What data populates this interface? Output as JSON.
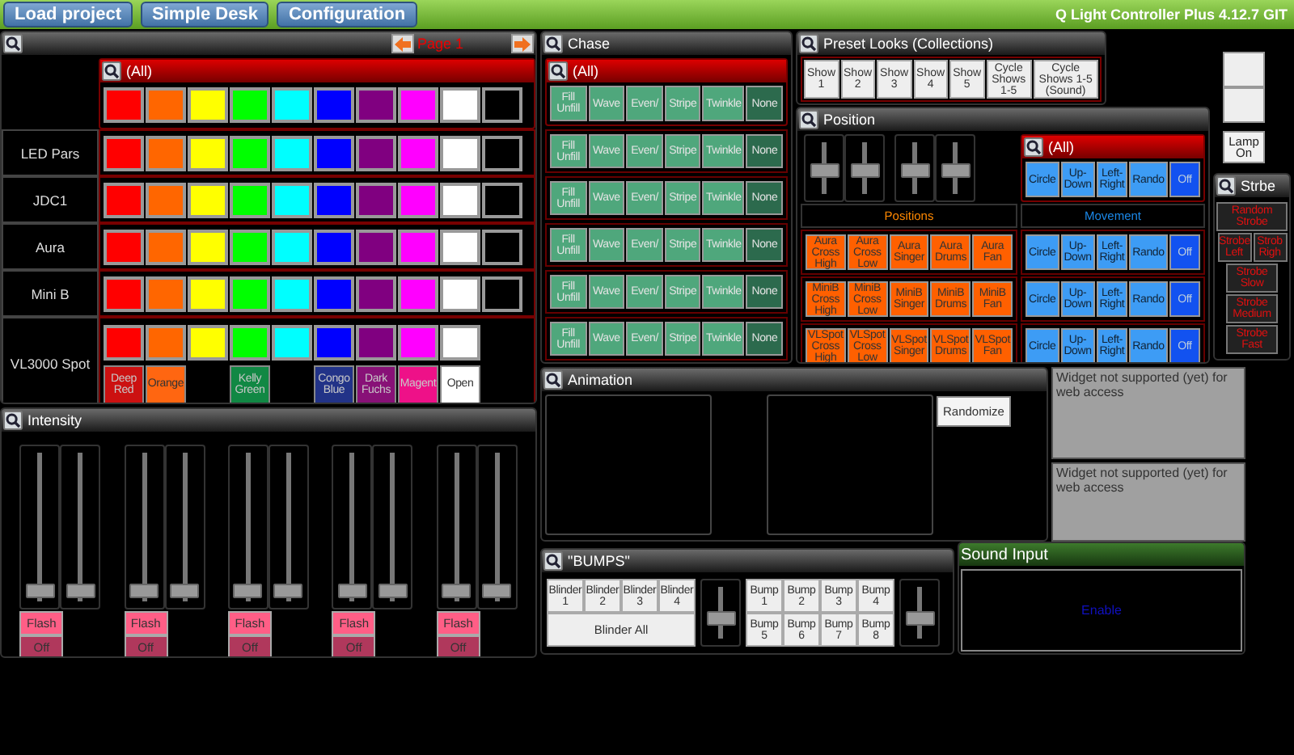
{
  "toolbar": {
    "buttons": [
      "Load project",
      "Simple Desk",
      "Configuration"
    ],
    "title": "Q Light Controller Plus 4.12.7 GIT"
  },
  "main": {
    "page": "Page 1",
    "all": {
      "title": "(All)",
      "colors": [
        {
          "color": "#ff0000"
        },
        {
          "color": "#ff6600"
        },
        {
          "color": "#ffff00"
        },
        {
          "color": "#00ff00"
        },
        {
          "color": "#00ffff"
        },
        {
          "color": "#0000ff"
        },
        {
          "color": "#800080"
        },
        {
          "color": "#ff00ff"
        },
        {
          "color": "#ffffff"
        },
        {
          "color": "#000000"
        }
      ]
    },
    "fixtures": [
      {
        "name": "LED Pars",
        "colors": [
          {
            "color": "#ff0000"
          },
          {
            "color": "#ff6600"
          },
          {
            "color": "#ffff00"
          },
          {
            "color": "#00ff00"
          },
          {
            "color": "#00ffff"
          },
          {
            "color": "#0000ff"
          },
          {
            "color": "#800080"
          },
          {
            "color": "#ff00ff"
          },
          {
            "color": "#ffffff"
          },
          {
            "color": "#000000"
          }
        ]
      },
      {
        "name": "JDC1",
        "colors": [
          {
            "color": "#ff0000"
          },
          {
            "color": "#ff6600"
          },
          {
            "color": "#ffff00"
          },
          {
            "color": "#00ff00"
          },
          {
            "color": "#00ffff"
          },
          {
            "color": "#0000ff"
          },
          {
            "color": "#800080"
          },
          {
            "color": "#ff00ff"
          },
          {
            "color": "#ffffff"
          },
          {
            "color": "#000000"
          }
        ]
      },
      {
        "name": "Aura",
        "colors": [
          {
            "color": "#ff0000"
          },
          {
            "color": "#ff6600"
          },
          {
            "color": "#ffff00"
          },
          {
            "color": "#00ff00"
          },
          {
            "color": "#00ffff"
          },
          {
            "color": "#0000ff"
          },
          {
            "color": "#800080"
          },
          {
            "color": "#ff00ff"
          },
          {
            "color": "#ffffff"
          },
          {
            "color": "#000000"
          }
        ]
      },
      {
        "name": "Mini B",
        "colors": [
          {
            "color": "#ff0000"
          },
          {
            "color": "#ff6600"
          },
          {
            "color": "#ffff00"
          },
          {
            "color": "#00ff00"
          },
          {
            "color": "#00ffff"
          },
          {
            "color": "#0000ff"
          },
          {
            "color": "#800080"
          },
          {
            "color": "#ff00ff"
          },
          {
            "color": "#ffffff"
          },
          {
            "color": "#000000"
          }
        ]
      },
      {
        "name": "VL3000 Spot",
        "colors": [
          {
            "color": "#ff0000"
          },
          {
            "color": "#ff6600"
          },
          {
            "color": "#ffff00"
          },
          {
            "color": "#00ff00"
          },
          {
            "color": "#00ffff"
          },
          {
            "color": "#0000ff"
          },
          {
            "color": "#800080"
          },
          {
            "color": "#ff00ff"
          },
          {
            "color": "#ffffff"
          }
        ],
        "presets": [
          {
            "kind": "button",
            "label": "Deep Red",
            "color": "#cc1111"
          },
          {
            "kind": "button",
            "label": "Orange",
            "color": "#ff6611"
          },
          {
            "kind": "blank"
          },
          {
            "kind": "button",
            "label": "Kelly Green",
            "color": "#118844"
          },
          {
            "kind": "blank"
          },
          {
            "kind": "button",
            "label": "Congo Blue",
            "color": "#223388"
          },
          {
            "kind": "button",
            "label": "Dark Fuchs",
            "color": "#881177"
          },
          {
            "kind": "button",
            "label": "Magent",
            "color": "#ee1188"
          },
          {
            "kind": "button",
            "label": "Open",
            "color": "#ffffff"
          }
        ]
      }
    ]
  },
  "chase": {
    "title": "Chase",
    "group": "(All)",
    "rows": [
      {
        "buttons": [
          {
            "label": "Fill Unfill",
            "selected": false
          },
          {
            "label": "Wave",
            "selected": false
          },
          {
            "label": "Even/",
            "selected": false
          },
          {
            "label": "Stripe",
            "selected": false
          },
          {
            "label": "Twinkle",
            "selected": false
          },
          {
            "label": "None",
            "selected": true
          }
        ]
      },
      {
        "buttons": [
          {
            "label": "Fill Unfill",
            "selected": false
          },
          {
            "label": "Wave",
            "selected": false
          },
          {
            "label": "Even/",
            "selected": false
          },
          {
            "label": "Stripe",
            "selected": false
          },
          {
            "label": "Twinkle",
            "selected": false
          },
          {
            "label": "None",
            "selected": true
          }
        ]
      },
      {
        "buttons": [
          {
            "label": "Fill Unfill",
            "selected": false
          },
          {
            "label": "Wave",
            "selected": false
          },
          {
            "label": "Even/",
            "selected": false
          },
          {
            "label": "Stripe",
            "selected": false
          },
          {
            "label": "Twinkle",
            "selected": false
          },
          {
            "label": "None",
            "selected": true
          }
        ]
      },
      {
        "buttons": [
          {
            "label": "Fill Unfill",
            "selected": false
          },
          {
            "label": "Wave",
            "selected": false
          },
          {
            "label": "Even/",
            "selected": false
          },
          {
            "label": "Stripe",
            "selected": false
          },
          {
            "label": "Twinkle",
            "selected": false
          },
          {
            "label": "None",
            "selected": true
          }
        ]
      },
      {
        "buttons": [
          {
            "label": "Fill Unfill",
            "selected": false
          },
          {
            "label": "Wave",
            "selected": false
          },
          {
            "label": "Even/",
            "selected": false
          },
          {
            "label": "Stripe",
            "selected": false
          },
          {
            "label": "Twinkle",
            "selected": false
          },
          {
            "label": "None",
            "selected": true
          }
        ]
      },
      {
        "buttons": [
          {
            "label": "Fill Unfill",
            "selected": false
          },
          {
            "label": "Wave",
            "selected": false
          },
          {
            "label": "Even/",
            "selected": false
          },
          {
            "label": "Stripe",
            "selected": false
          },
          {
            "label": "Twinkle",
            "selected": false
          },
          {
            "label": "None",
            "selected": true
          }
        ]
      }
    ]
  },
  "preset_looks": {
    "title": "Preset Looks (Collections)",
    "buttons": [
      "Show 1",
      "Show 2",
      "Show 3",
      "Show 4",
      "Show 5",
      "Cycle Shows 1-5",
      "Cycle Shows 1-5 (Sound)"
    ]
  },
  "side_buttons": [
    {
      "kind": "blank"
    },
    {
      "kind": "blank"
    },
    {
      "kind": "labeled",
      "label": "Lamp On"
    }
  ],
  "position": {
    "title": "Position",
    "sliders": [
      {
        "level": 0.45
      },
      {
        "level": 0.45
      },
      {
        "level": 0.45
      },
      {
        "level": 0.45
      }
    ],
    "positions_label": "Positions",
    "movement_label": "Movement",
    "positions": [
      {
        "buttons": [
          "Aura Cross High",
          "Aura Cross Low",
          "Aura Singer",
          "Aura Drums",
          "Aura Fan"
        ]
      },
      {
        "buttons": [
          "MiniB Cross High",
          "MiniB Cross Low",
          "MiniB Singer",
          "MiniB Drums",
          "MiniB Fan"
        ]
      },
      {
        "buttons": [
          "VLSpot Cross High",
          "VLSpot Cross Low",
          "VLSpot Singer",
          "VLSpot Drums",
          "VLSpot Fan"
        ]
      }
    ],
    "movement_group": {
      "title": "(All)",
      "buttons": [
        {
          "label": "Circle",
          "selected": false
        },
        {
          "label": "Up-Down",
          "selected": false
        },
        {
          "label": "Left-Right",
          "selected": false
        },
        {
          "label": "Rando",
          "selected": false
        },
        {
          "label": "Off",
          "selected": true
        }
      ]
    },
    "movement": [
      {
        "buttons": [
          {
            "label": "Circle",
            "selected": false
          },
          {
            "label": "Up-Down",
            "selected": false
          },
          {
            "label": "Left-Right",
            "selected": false
          },
          {
            "label": "Rando",
            "selected": false
          },
          {
            "label": "Off",
            "selected": true
          }
        ]
      },
      {
        "buttons": [
          {
            "label": "Circle",
            "selected": false
          },
          {
            "label": "Up-Down",
            "selected": false
          },
          {
            "label": "Left-Right",
            "selected": false
          },
          {
            "label": "Rando",
            "selected": false
          },
          {
            "label": "Off",
            "selected": true
          }
        ]
      },
      {
        "buttons": [
          {
            "label": "Circle",
            "selected": false
          },
          {
            "label": "Up-Down",
            "selected": false
          },
          {
            "label": "Left-Right",
            "selected": false
          },
          {
            "label": "Rando",
            "selected": false
          },
          {
            "label": "Off",
            "selected": true
          }
        ]
      }
    ]
  },
  "strobe": {
    "title": "Strbe",
    "buttons": [
      {
        "kind": "wide",
        "label": "Random Strobe"
      },
      {
        "kind": "half",
        "label": "Strobe Left"
      },
      {
        "kind": "half",
        "label": "Strob Righ"
      },
      {
        "kind": "narrow",
        "label": "Strobe Slow"
      },
      {
        "kind": "narrow",
        "label": "Strobe Medium"
      },
      {
        "kind": "narrow",
        "label": "Strobe Fast"
      }
    ]
  },
  "intensity": {
    "title": "Intensity",
    "channels": [
      {
        "sliders": [
          {
            "level": 0.03
          },
          {
            "level": 0.03
          }
        ],
        "flash": "Flash",
        "off": "Off"
      },
      {
        "sliders": [
          {
            "level": 0.03
          },
          {
            "level": 0.03
          }
        ],
        "flash": "Flash",
        "off": "Off"
      },
      {
        "sliders": [
          {
            "level": 0.03
          },
          {
            "level": 0.03
          }
        ],
        "flash": "Flash",
        "off": "Off"
      },
      {
        "sliders": [
          {
            "level": 0.03
          },
          {
            "level": 0.03
          }
        ],
        "flash": "Flash",
        "off": "Off"
      },
      {
        "sliders": [
          {
            "level": 0.03
          },
          {
            "level": 0.03
          }
        ],
        "flash": "Flash",
        "off": "Off"
      }
    ]
  },
  "animation": {
    "title": "Animation",
    "button": "Randomize"
  },
  "unsupported": [
    "Widget not supported (yet) for web access",
    "Widget not supported (yet) for web access"
  ],
  "bumps": {
    "title": "\"BUMPS\"",
    "blinders": [
      "Blinder 1",
      "Blinder 2",
      "Blinder 3",
      "Blinder 4"
    ],
    "blinder_all": "Blinder All",
    "blinder_slider": {
      "level": 0.35
    },
    "bumps": [
      "Bump 1",
      "Bump 2",
      "Bump 3",
      "Bump 4",
      "Bump 5",
      "Bump 6",
      "Bump 7",
      "Bump 8"
    ],
    "bump_slider": {
      "level": 0.35
    }
  },
  "sound": {
    "title": "Sound Input",
    "button": "Enable"
  }
}
